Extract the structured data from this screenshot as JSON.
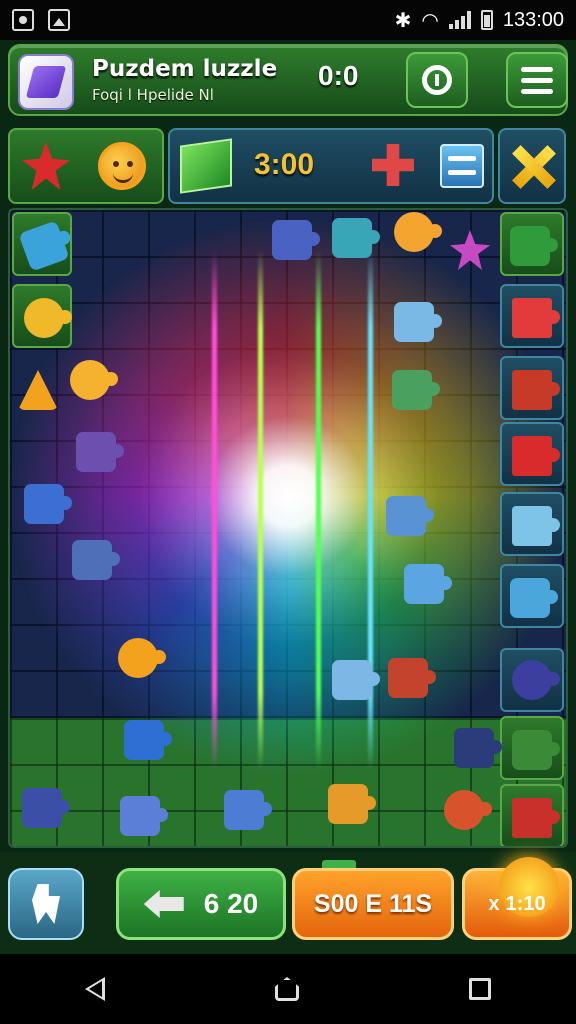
{
  "status_bar": {
    "time": "133:00"
  },
  "header": {
    "title": "Puzdem luzzle",
    "subtitle": "Foqi l Hpelide Nl",
    "timer": "0:0"
  },
  "row2": {
    "timer": "3:00"
  },
  "bottom_bar": {
    "score": "6 20",
    "sort_label": "S00 E 11S",
    "boost_multiplier": "x",
    "boost_value": "1:10"
  },
  "colors": {
    "accent_green": "#2f7d2c",
    "board_blue": "#17264a",
    "orange": "#ff9a1f",
    "gold": "#f1c232"
  },
  "icons": [
    "camera-icon",
    "image-icon",
    "bluetooth-icon",
    "wifi-icon",
    "signal-icon",
    "battery-icon",
    "hint-icon",
    "menu-icon",
    "back-icon",
    "home-icon",
    "recents-icon"
  ]
}
